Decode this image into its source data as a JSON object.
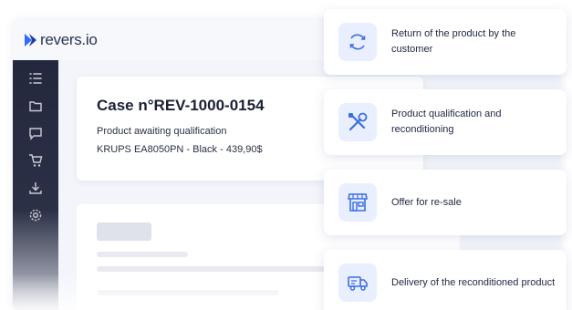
{
  "app": {
    "brand": "revers.io",
    "brand_color": "#2f6bff",
    "text_color": "#2a3554"
  },
  "sidebar": {
    "items": [
      {
        "icon": "list-icon"
      },
      {
        "icon": "folder-icon"
      },
      {
        "icon": "chat-icon"
      },
      {
        "icon": "cart-icon"
      },
      {
        "icon": "download-icon"
      },
      {
        "icon": "gear-icon"
      }
    ]
  },
  "case": {
    "title": "Case n°REV-1000-0154",
    "status": "Product awaiting qualification",
    "product": "KRUPS EA8050PN - Black - 439,90$"
  },
  "steps": [
    {
      "icon": "refresh-icon",
      "label": "Return of the product by the customer"
    },
    {
      "icon": "tools-icon",
      "label": "Product qualification and reconditioning"
    },
    {
      "icon": "store-icon",
      "label": "Offer for re-sale"
    },
    {
      "icon": "truck-icon",
      "label": "Delivery of the reconditioned product"
    }
  ],
  "colors": {
    "accent": "#3a6ee8",
    "icon_bg": "#e9efff",
    "sidebar": "#23283d"
  }
}
